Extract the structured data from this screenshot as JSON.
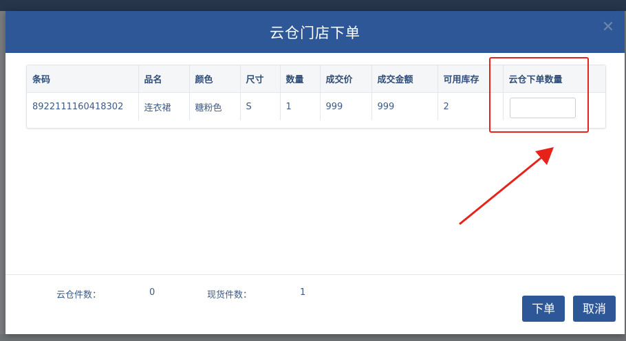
{
  "dialog": {
    "title": "云仓门店下单",
    "close_icon": "close-icon"
  },
  "table": {
    "headers": [
      "条码",
      "品名",
      "颜色",
      "尺寸",
      "数量",
      "成交价",
      "成交金额",
      "可用库存",
      "云仓下单数量"
    ],
    "rows": [
      {
        "barcode": "8922111160418302",
        "name": "连衣裙",
        "color": "糖粉色",
        "size": "S",
        "quantity": "1",
        "price": "999",
        "amount": "999",
        "available_stock": "2",
        "cloud_order_qty": ""
      }
    ]
  },
  "footer": {
    "cloud_count_label": "云仓件数：",
    "cloud_count_value": "0",
    "stock_count_label": "现货件数：",
    "stock_count_value": "1",
    "submit_label": "下单",
    "cancel_label": "取消"
  },
  "colors": {
    "header_bg": "#2d5797",
    "button_bg": "#2d5797",
    "annotation_red": "#e5231a"
  }
}
